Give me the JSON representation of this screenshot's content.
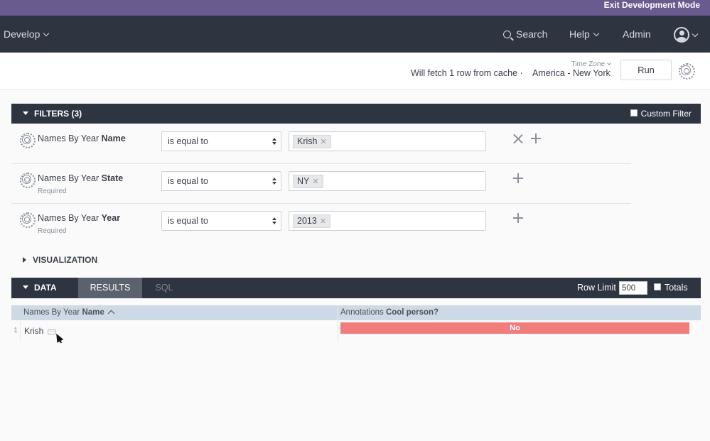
{
  "devbar": {
    "exit_label": "Exit Development Mode"
  },
  "nav": {
    "develop_label": "Develop",
    "search_label": "Search",
    "help_label": "Help",
    "admin_label": "Admin"
  },
  "toolbar": {
    "timezone_label": "Time Zone",
    "cache_text": "Will fetch 1 row from cache ·",
    "timezone_value": "America - New York",
    "run_label": "Run"
  },
  "filters": {
    "title": "FILTERS (3)",
    "custom_filter_label": "Custom Filter",
    "rows": [
      {
        "view": "Names By Year",
        "field": "Name",
        "required": "",
        "operator": "is equal to",
        "value": "Krish"
      },
      {
        "view": "Names By Year",
        "field": "State",
        "required": "Required",
        "operator": "is equal to",
        "value": "NY"
      },
      {
        "view": "Names By Year",
        "field": "Year",
        "required": "Required",
        "operator": "is equal to",
        "value": "2013"
      }
    ]
  },
  "visualization": {
    "title": "VISUALIZATION"
  },
  "data_section": {
    "title": "DATA",
    "tabs": [
      "RESULTS",
      "SQL"
    ],
    "active_tab": "RESULTS",
    "row_limit_label": "Row Limit",
    "row_limit_value": "500",
    "totals_label": "Totals"
  },
  "results_table": {
    "columns": [
      {
        "view": "Names By Year",
        "field": "Name"
      },
      {
        "view": "Annotations",
        "field": "Cool person?"
      }
    ],
    "rows": [
      {
        "num": "1",
        "name": "Krish",
        "cool": "No"
      }
    ]
  },
  "colors": {
    "devbar": "#6a5a8e",
    "navbar": "#2f3441",
    "active_tab": "#5c626d",
    "header_row": "#cdd9e4",
    "cool_no": "#f07c7c"
  },
  "icons": [
    "search-icon",
    "user-avatar-icon",
    "settings-gear-icon",
    "remove-x-icon",
    "add-plus-icon",
    "sort-ascending-icon",
    "ellipsis-icon"
  ]
}
